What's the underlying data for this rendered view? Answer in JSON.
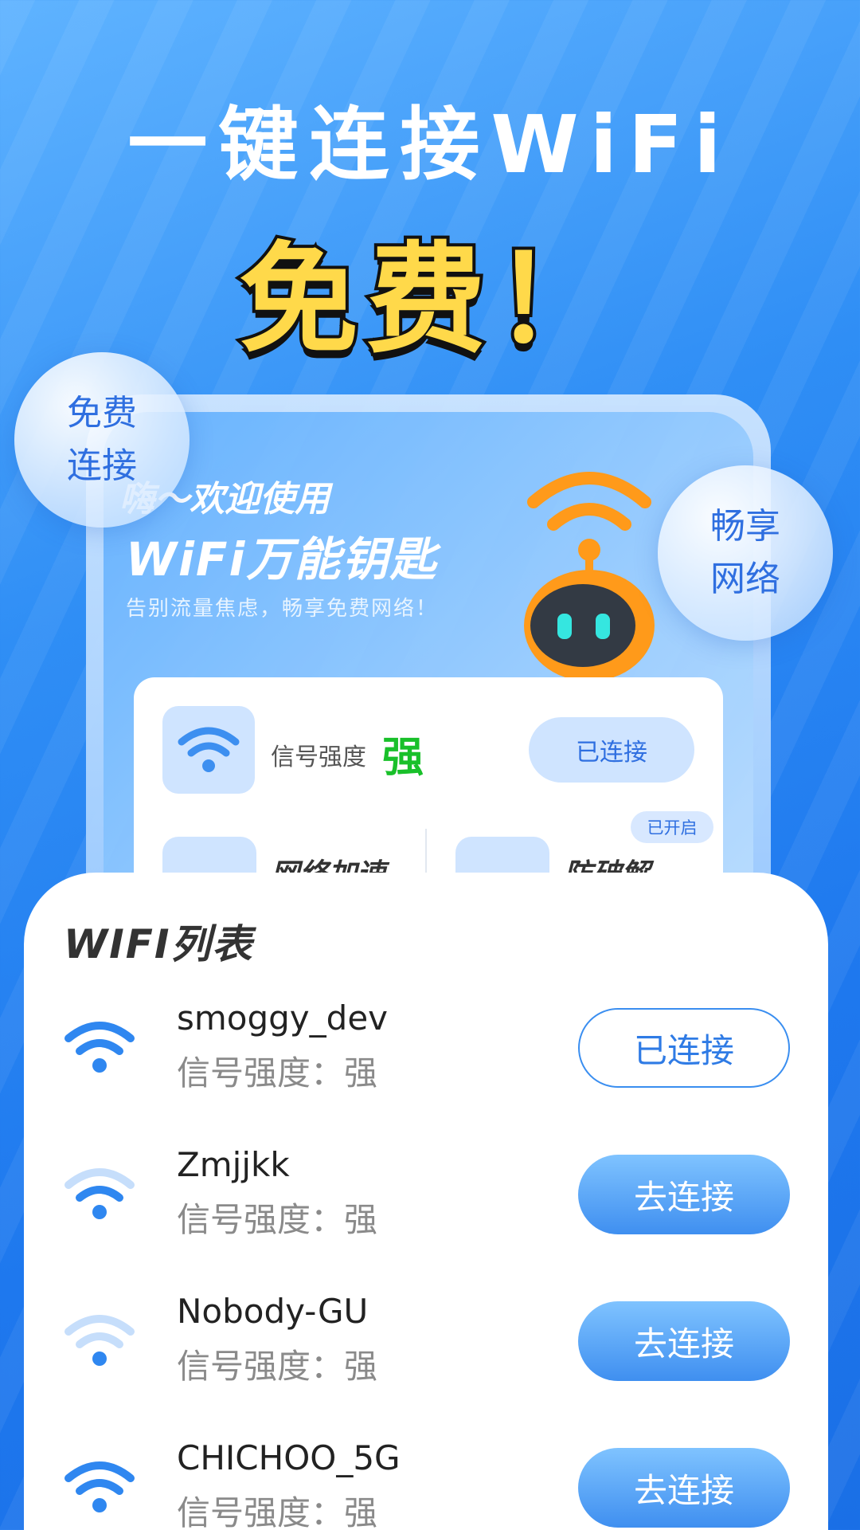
{
  "hero": {
    "line1": "一键连接WiFi",
    "line2": "免费！"
  },
  "bubbles": {
    "left": "免费\n连接",
    "right": "畅享\n网络"
  },
  "banner": {
    "welcome": "嗨～欢迎使用",
    "app_name": "WiFi万能钥匙",
    "tagline": "告别流量焦虑，畅享免费网络！"
  },
  "status_card": {
    "signal_label": "信号强度",
    "signal_value": "强",
    "status_button": "已连接",
    "enabled_badge": "已开启",
    "features": [
      "网络加速",
      "防破解"
    ]
  },
  "wifi_list": {
    "title": "WIFI列表",
    "items": [
      {
        "ssid": "smoggy_dev",
        "signal": "信号强度：强",
        "action": "已连接",
        "connected": true
      },
      {
        "ssid": "Zmjjkk",
        "signal": "信号强度：强",
        "action": "去连接",
        "connected": false
      },
      {
        "ssid": "Nobody-GU",
        "signal": "信号强度：强",
        "action": "去连接",
        "connected": false
      },
      {
        "ssid": "CHICHOO_5G",
        "signal": "信号强度：强",
        "action": "去连接",
        "connected": false
      }
    ]
  },
  "colors": {
    "accent": "#2f7be5",
    "hero_highlight": "#ffd94a",
    "signal_strong": "#19c02a"
  }
}
